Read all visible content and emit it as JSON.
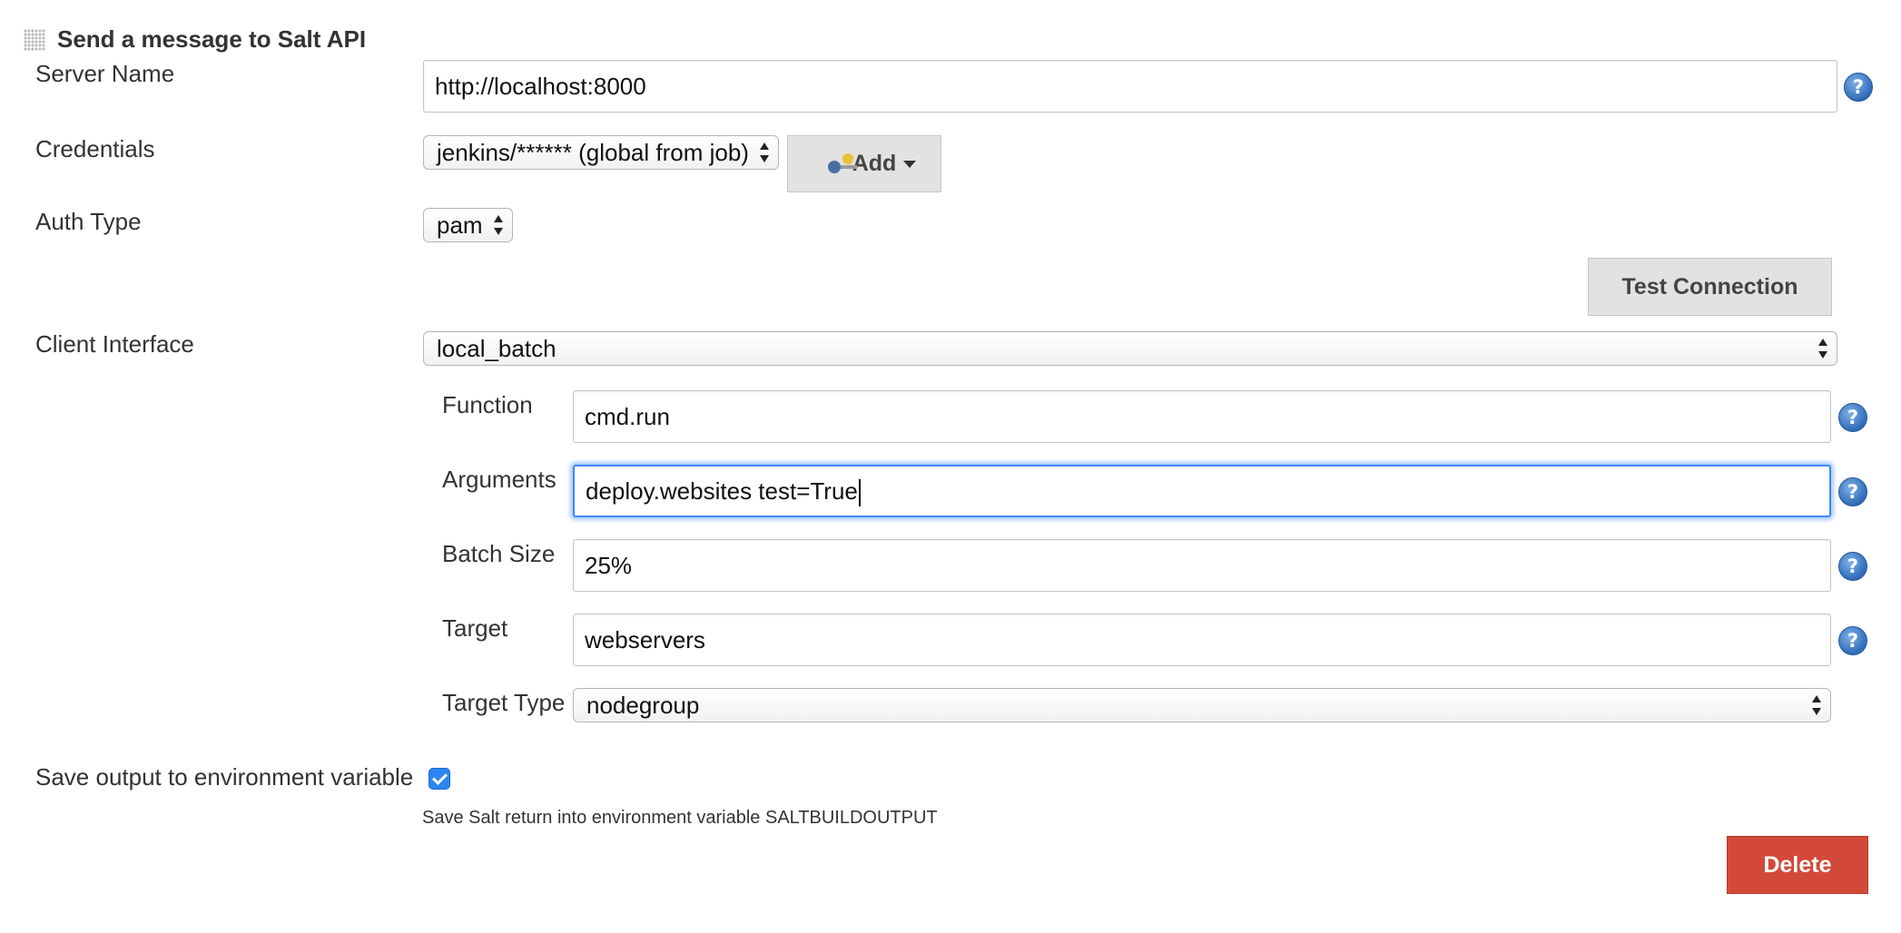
{
  "section": {
    "title": "Send a message to Salt API"
  },
  "server_name": {
    "label": "Server Name",
    "value": "http://localhost:8000"
  },
  "credentials": {
    "label": "Credentials",
    "selected": "jenkins/****** (global from job)",
    "add_label": "Add"
  },
  "auth_type": {
    "label": "Auth Type",
    "selected": "pam"
  },
  "test_connection": {
    "label": "Test Connection"
  },
  "client_interface": {
    "label": "Client Interface",
    "selected": "local_batch"
  },
  "function": {
    "label": "Function",
    "value": "cmd.run"
  },
  "arguments": {
    "label": "Arguments",
    "value": "deploy.websites test=True"
  },
  "batch_size": {
    "label": "Batch Size",
    "value": "25%"
  },
  "target": {
    "label": "Target",
    "value": "webservers"
  },
  "target_type": {
    "label": "Target Type",
    "selected": "nodegroup"
  },
  "save_output": {
    "label": "Save output to environment variable",
    "checked": true,
    "description": "Save Salt return into environment variable SALTBUILDOUTPUT"
  },
  "delete": {
    "label": "Delete"
  },
  "help": {
    "symbol": "?"
  },
  "colors": {
    "accent": "#3d8af7",
    "danger": "#d24939",
    "help": "#2f6cb8"
  },
  "icons": [
    "grip-icon",
    "key-icon",
    "help-icon",
    "chevron-down-icon",
    "select-arrows-icon",
    "checkmark-icon"
  ]
}
